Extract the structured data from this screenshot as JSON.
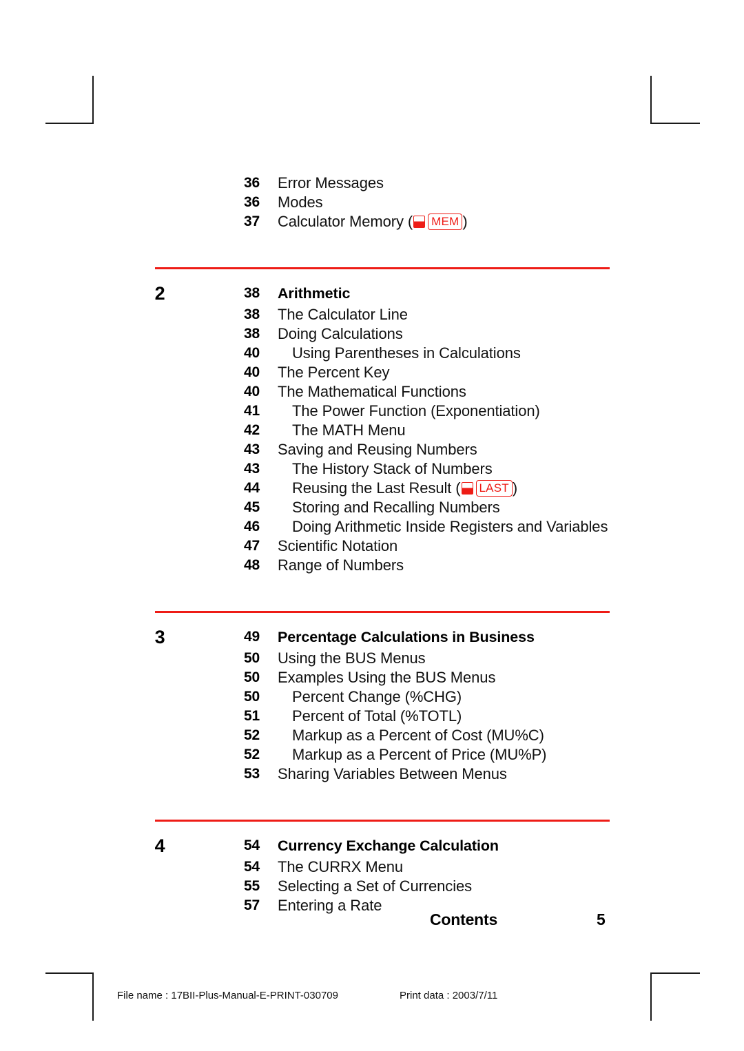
{
  "document": {
    "running_footer_label": "Contents",
    "folio": "5",
    "accent_color": "#ee1c16",
    "text_color": "#111111"
  },
  "print_slug": {
    "file_name": "File name : 17BII-Plus-Manual-E-PRINT-030709",
    "print_date": "Print data : 2003/7/11"
  },
  "toc": {
    "continued_entries": [
      {
        "page": "36",
        "title": "Error Messages",
        "level": 1
      },
      {
        "page": "36",
        "title": "Modes",
        "level": 1
      },
      {
        "page": "37",
        "title": "Calculator Memory (",
        "level": 1,
        "key": "MEM",
        "title_suffix": ")"
      }
    ],
    "chapters": [
      {
        "chapter": "2",
        "page": "38",
        "title": "Arithmetic",
        "entries": [
          {
            "page": "38",
            "title": "The Calculator Line",
            "level": 1
          },
          {
            "page": "38",
            "title": "Doing Calculations",
            "level": 1
          },
          {
            "page": "40",
            "title": "Using Parentheses in Calculations",
            "level": 2
          },
          {
            "page": "40",
            "title": "The Percent Key",
            "level": 1
          },
          {
            "page": "40",
            "title": "The Mathematical Functions",
            "level": 1
          },
          {
            "page": "41",
            "title": "The Power Function (Exponentiation)",
            "level": 2
          },
          {
            "page": "42",
            "title": "The MATH Menu",
            "level": 2
          },
          {
            "page": "43",
            "title": "Saving and Reusing Numbers",
            "level": 1
          },
          {
            "page": "43",
            "title": "The History Stack of Numbers",
            "level": 2
          },
          {
            "page": "44",
            "title": "Reusing the Last Result (",
            "level": 2,
            "key": "LAST",
            "title_suffix": ")"
          },
          {
            "page": "45",
            "title": "Storing and Recalling Numbers",
            "level": 2
          },
          {
            "page": "46",
            "title": "Doing Arithmetic Inside Registers and Variables",
            "level": 2
          },
          {
            "page": "47",
            "title": "Scientific Notation",
            "level": 1
          },
          {
            "page": "48",
            "title": "Range of Numbers",
            "level": 1
          }
        ]
      },
      {
        "chapter": "3",
        "page": "49",
        "title": "Percentage Calculations in Business",
        "entries": [
          {
            "page": "50",
            "title": "Using the BUS Menus",
            "level": 1
          },
          {
            "page": "50",
            "title": "Examples Using the BUS Menus",
            "level": 1
          },
          {
            "page": "50",
            "title": "Percent Change (%CHG)",
            "level": 2
          },
          {
            "page": "51",
            "title": "Percent of Total (%TOTL)",
            "level": 2
          },
          {
            "page": "52",
            "title": "Markup as a Percent of Cost (MU%C)",
            "level": 2
          },
          {
            "page": "52",
            "title": "Markup as a Percent of Price (MU%P)",
            "level": 2
          },
          {
            "page": "53",
            "title": "Sharing Variables Between Menus",
            "level": 1
          }
        ]
      },
      {
        "chapter": "4",
        "page": "54",
        "title": "Currency Exchange Calculation",
        "entries": [
          {
            "page": "54",
            "title": "The CURRX Menu",
            "level": 1
          },
          {
            "page": "55",
            "title": "Selecting a Set of Currencies",
            "level": 1
          },
          {
            "page": "57",
            "title": "Entering a Rate",
            "level": 1
          }
        ]
      }
    ]
  }
}
